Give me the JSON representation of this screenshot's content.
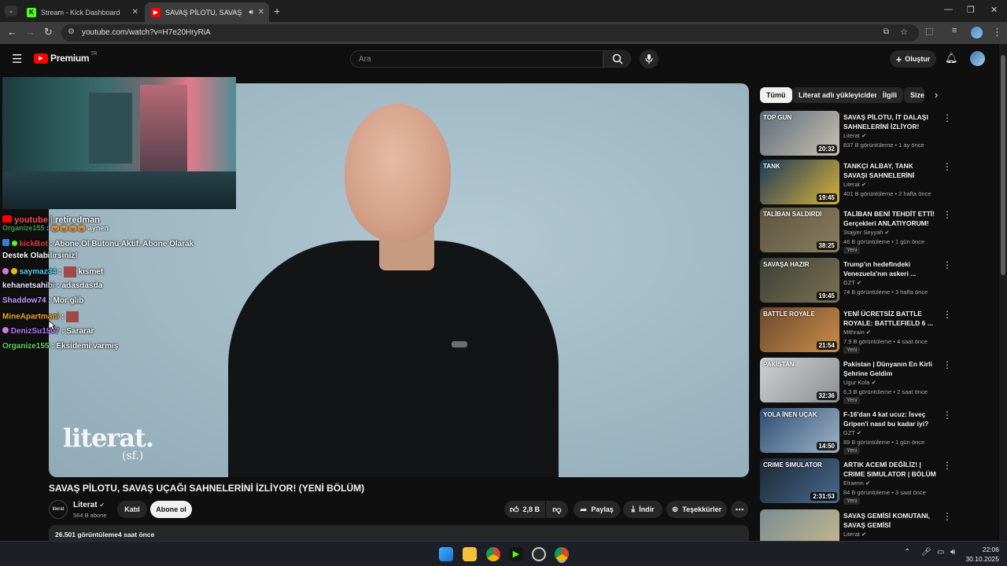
{
  "browser": {
    "tabs": [
      {
        "label": "Stream - Kick Dashboard",
        "active": false
      },
      {
        "label": "SAVAŞ PİLOTU, SAVAŞ UÇAĞ",
        "active": true
      }
    ],
    "url": "youtube.com/watch?v=H7e20HryRiA"
  },
  "youtube": {
    "logo_text": "Premium",
    "region": "TR",
    "search_placeholder": "Ara",
    "create_label": "Oluştur"
  },
  "overlay": {
    "chat_header": {
      "platform": "youtube",
      "name": "retiredman"
    },
    "chat": [
      {
        "user": "Organize155",
        "text": ": 🎃🎃🎃🎃 aynen"
      },
      {
        "user": "kickBot",
        "text": ": Abone Ol Butonu Aktif. Abone Olarak"
      },
      {
        "user": "",
        "text": "Destek Olabilirsiniz!"
      },
      {
        "user": "saymaz34",
        "text": ": kısmet"
      },
      {
        "user": "kehanetsahibi",
        "text": ": adasdasda"
      },
      {
        "user": "Shaddow74",
        "text": ": Mor glib"
      },
      {
        "user": "MineApartmani",
        "text": ":"
      },
      {
        "user": "DenizSu1907",
        "text": ": Sararar"
      },
      {
        "user": "Organize155",
        "text": ": Eksidemi varmış"
      }
    ],
    "video_logo": {
      "main": "literat.",
      "sub": "(sf.)"
    }
  },
  "video": {
    "title": "SAVAŞ PİLOTU, SAVAŞ UÇAĞI SAHNELERİNİ İZLİYOR! (YENİ BÖLÜM)",
    "channel": "Literat",
    "channel_avatar": "literat",
    "subscribers": "564 B abone",
    "join_label": "Katıl",
    "subscribe_label": "Abone ol",
    "likes": "2,8 B",
    "share_label": "Paylaş",
    "download_label": "İndir",
    "thanks_label": "Teşekkürler",
    "views": "26.501 görüntüleme",
    "published": "4 saat önce"
  },
  "sidebar": {
    "chips": [
      "Tümü",
      "Literat adlı yükleyiciden",
      "İlgili",
      "Size"
    ],
    "recommendations": [
      {
        "title": "SAVAŞ PİLOTU, İT DALAŞI SAHNELERİNİ İZLİYOR!",
        "channel": "Literat",
        "meta": "837 B görüntüleme • 1 ay önce",
        "duration": "20:32",
        "badge": "",
        "thumb_text": "TOP GUN",
        "c1": "#5b6a78",
        "c2": "#c9c2b3"
      },
      {
        "title": "TANKÇI ALBAY, TANK SAVAŞI SAHNELERİNİ YORUMLUYOR!",
        "channel": "Literat",
        "meta": "401 B görüntüleme • 2 hafta önce",
        "duration": "19:45",
        "badge": "",
        "thumb_text": "TANK",
        "c1": "#1c3a5a",
        "c2": "#d9b13a"
      },
      {
        "title": "TALİBAN BENİ TEHDİT ETTİ! Gerçekleri ANLATIYORUM! ...",
        "channel": "Stajyer Seyyah",
        "meta": "46 B görüntüleme • 1 gün önce",
        "duration": "38:25",
        "badge": "Yeni",
        "thumb_text": "TALİBAN SALDIRDI",
        "c1": "#5c5540",
        "c2": "#8a7d5f"
      },
      {
        "title": "Trump'ın hedefindeki Venezuela'nın askeri ...",
        "channel": "GZT",
        "meta": "74 B görüntüleme • 3 hafta önce",
        "duration": "19:45",
        "badge": "",
        "thumb_text": "SAVAŞA HAZIR",
        "c1": "#3a3f35",
        "c2": "#7d7255"
      },
      {
        "title": "YENİ ÜCRETSİZ BATTLE ROYALE: BATTLEFIELD 6 ...",
        "channel": "Mithrain",
        "meta": "7.9 B görüntüleme • 4 saat önce",
        "duration": "21:54",
        "badge": "Yeni",
        "thumb_text": "BATTLE ROYALE",
        "c1": "#6d4a2c",
        "c2": "#c98c4a"
      },
      {
        "title": "Pakistan | Dünyanın En Kirli Şehrine Geldim",
        "channel": "Ugur Kola",
        "meta": "6,3 B görüntüleme • 2 saat önce",
        "duration": "32:36",
        "badge": "Yeni",
        "thumb_text": "PAKİSTAN",
        "c1": "#cfd2d4",
        "c2": "#8c8f92"
      },
      {
        "title": "F-16'dan 4 kat ucuz: İsveç Gripen'i nasıl bu kadar iyi?",
        "channel": "GZT",
        "meta": "89 B görüntüleme • 1 gün önce",
        "duration": "14:50",
        "badge": "Yeni",
        "thumb_text": "YOLA İNEN UÇAK",
        "c1": "#2d4d73",
        "c2": "#9fb4c7"
      },
      {
        "title": "ARTIK ACEMİ DEĞİLİZ! | CRIME SIMULATOR | BÖLÜM 2",
        "channel": "Elraenn",
        "meta": "84 B görüntüleme • 3 saat önce",
        "duration": "2:31:53",
        "badge": "Yeni",
        "thumb_text": "CRIME SIMULATOR",
        "c1": "#1b2735",
        "c2": "#4a6a8c"
      },
      {
        "title": "SAVAŞ GEMİSİ KOMUTANI, SAVAŞ GEMİSİ SAHNELERİNİ ...",
        "channel": "Literat",
        "meta": "",
        "duration": "",
        "badge": "",
        "thumb_text": "",
        "c1": "#7a8c94",
        "c2": "#c7b98c"
      }
    ]
  },
  "taskbar": {
    "time": "22:06",
    "date": "30.10.2025"
  }
}
